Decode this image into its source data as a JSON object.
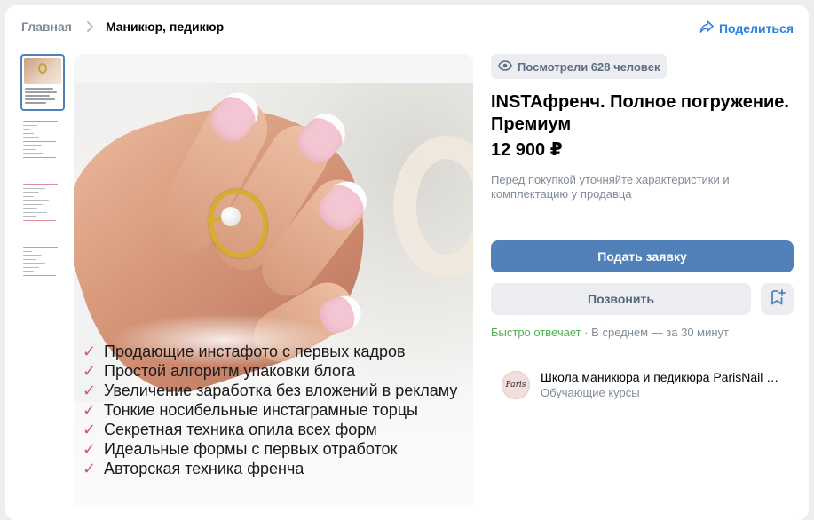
{
  "breadcrumb": {
    "home": "Главная",
    "current": "Маникюр, педикюр"
  },
  "share_label": "Поделиться",
  "views_label": "Посмотрели 628 человек",
  "product": {
    "title": "INSTAфренч. Полное погружение. Премиум",
    "price": "12 900 ₽",
    "note": "Перед покупкой уточняйте характеристики и комплектацию у продавца"
  },
  "buttons": {
    "apply": "Подать заявку",
    "call": "Позвонить"
  },
  "response": {
    "fast": "Быстро отвечает",
    "rest": " · В среднем — за 30 минут"
  },
  "seller": {
    "name": "Школа маникюра и педикюра ParisNail …",
    "category": "Обучающие курсы",
    "logo_text": "Paris"
  },
  "photo_features": [
    "Продающие инстафото с первых кадров",
    "Простой алгоритм упаковки блога",
    "Увеличение заработка без вложений в рекламу",
    "Тонкие носибельные инстаграмные торцы",
    "Секретная техника опила всех форм",
    "Идеальные формы с первых отработок",
    "Авторская техника френча"
  ],
  "colors": {
    "accent": "#5181b8",
    "link": "#2d81e0",
    "green": "#4bb34b",
    "muted": "#818c99"
  }
}
